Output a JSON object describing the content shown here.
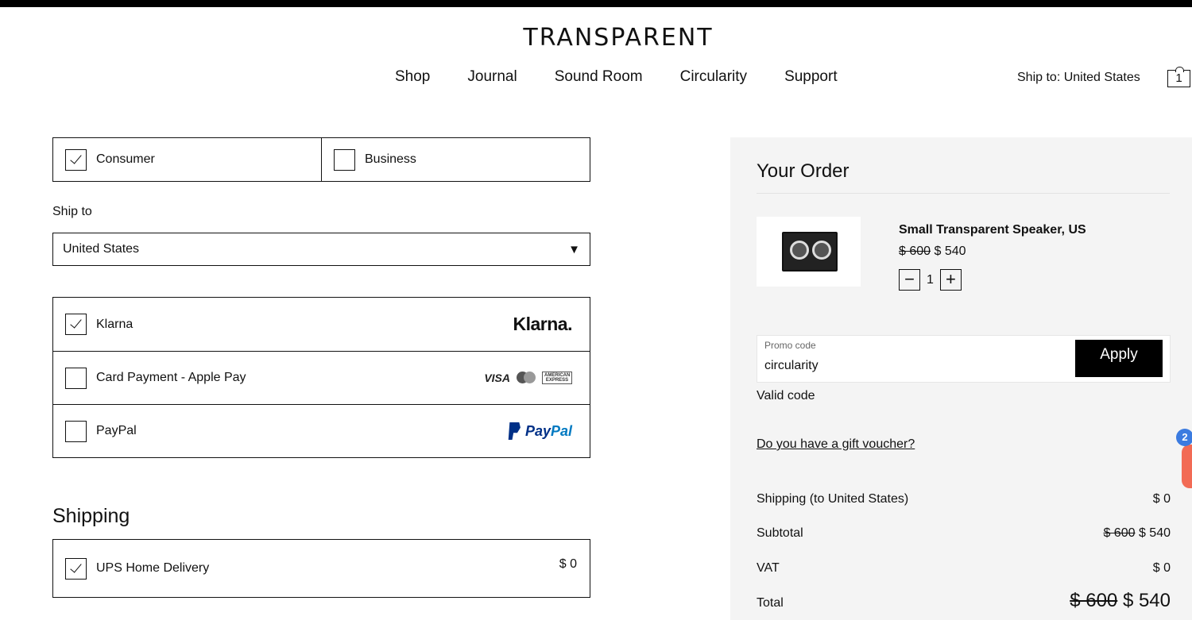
{
  "header": {
    "logo": "TRANSPARENT",
    "nav": [
      "Shop",
      "Journal",
      "Sound Room",
      "Circularity",
      "Support"
    ],
    "ship_to": "Ship to: United States",
    "cart_count": "1"
  },
  "customer_type": {
    "options": [
      {
        "label": "Consumer",
        "checked": true
      },
      {
        "label": "Business",
        "checked": false
      }
    ]
  },
  "ship_to": {
    "label": "Ship to",
    "selected": "United States"
  },
  "payment_methods": [
    {
      "label": "Klarna",
      "checked": true,
      "logo_text": "Klarna."
    },
    {
      "label": "Card Payment - Apple Pay",
      "checked": false,
      "logo_text": "VISA"
    },
    {
      "label": "PayPal",
      "checked": false,
      "logo_text": "PayPal"
    }
  ],
  "card_logos": {
    "amex": "AMERICAN EXPRESS"
  },
  "paypal_logo": {
    "pay": "Pay",
    "pal": "Pal"
  },
  "shipping": {
    "title": "Shipping",
    "method": "UPS Home Delivery",
    "checked": true,
    "price": "$ 0"
  },
  "order": {
    "title": "Your Order",
    "product": {
      "name": "Small Transparent Speaker, US",
      "old_price": "$ 600",
      "price": "$ 540",
      "qty": "1",
      "minus": "−",
      "plus": "+"
    },
    "promo": {
      "label": "Promo code",
      "value": "circularity",
      "apply": "Apply",
      "status": "Valid code"
    },
    "gift_link": "Do you have a gift voucher?",
    "shipping_label": "Shipping (to United States)",
    "shipping_value": "$ 0",
    "subtotal_label": "Subtotal",
    "subtotal_old": "$ 600",
    "subtotal_value": "$ 540",
    "vat_label": "VAT",
    "vat_value": "$ 0",
    "total_label": "Total",
    "total_old": "$ 600",
    "total_value": "$ 540"
  },
  "chat_badge": "2"
}
